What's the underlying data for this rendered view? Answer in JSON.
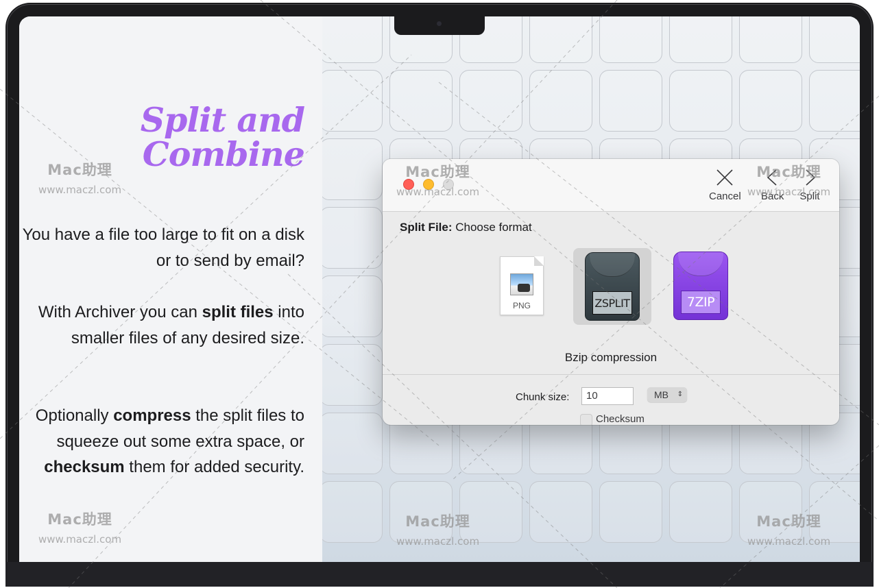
{
  "marketing": {
    "title_line1": "Split and",
    "title_line2": "Combine",
    "p1": "You have a file too large to fit on a disk or to send by email?",
    "p2_a": "With Archiver you can ",
    "p2_b": "split files",
    "p2_c": " into smaller files of any desired size.",
    "p3_a": "Optionally ",
    "p3_b": "compress",
    "p3_c": " the split files to squeeze out some extra space, or ",
    "p3_d": "checksum",
    "p3_e": " them for added security."
  },
  "dialog": {
    "toolbar": {
      "cancel_label": "Cancel",
      "back_label": "Back",
      "split_label": "Split"
    },
    "heading_bold": "Split File:",
    "heading_rest": " Choose format",
    "formats": [
      {
        "name": "PNG",
        "icon": "png-file-icon",
        "selected": false
      },
      {
        "name": "ZSPLIT",
        "icon": "zsplit-archive-icon",
        "selected": true
      },
      {
        "name": "7ZIP",
        "icon": "7zip-archive-icon",
        "selected": false
      }
    ],
    "selected_caption": "Bzip compression",
    "chunk_label": "Chunk size:",
    "chunk_value": "10",
    "unit": "MB",
    "checksum_label": "Checksum",
    "checksum_checked": false
  },
  "watermark": {
    "brand": "Mac助理",
    "url": "www.maczl.com"
  },
  "colors": {
    "title_accent": "#a868ee",
    "close": "#ff5f57",
    "minimize": "#febc2e",
    "zoom_disabled": "#dcdcdc",
    "zip_purple": "#8a44e8"
  }
}
